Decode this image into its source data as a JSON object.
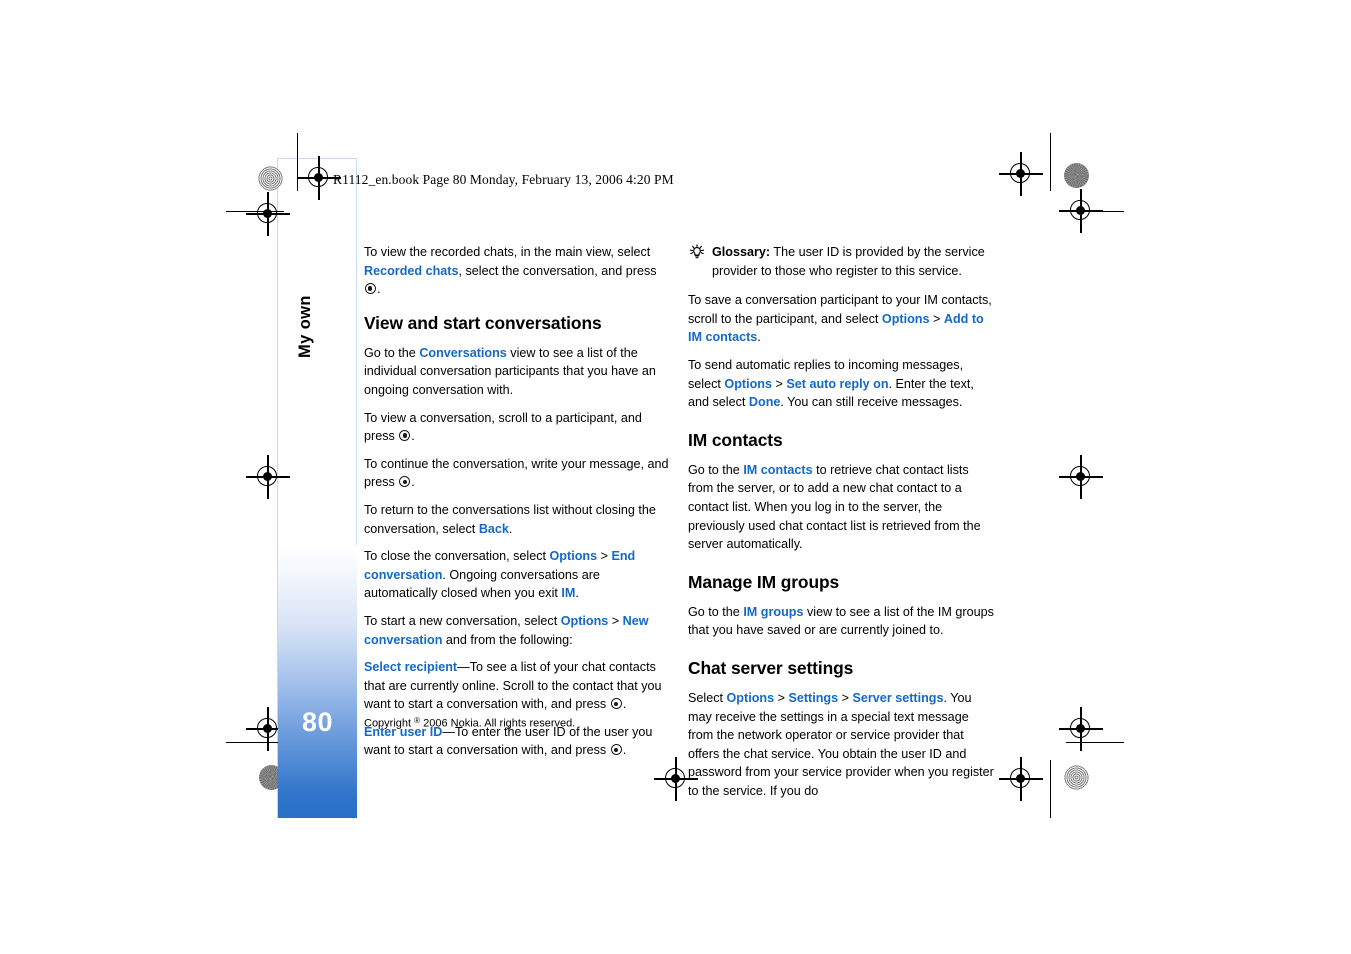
{
  "prepress": {
    "running_header": "R1112_en.book  Page 80  Monday, February 13, 2006  4:20 PM"
  },
  "tab": {
    "page_number": "80",
    "chapter_label": "My own"
  },
  "left_column": {
    "intro": {
      "before": "To view the recorded chats, in the main view, select ",
      "link": "Recorded chats",
      "after": ", select the conversation, and press "
    },
    "heading": "View and start conversations",
    "p1": {
      "before": "Go to the ",
      "link": "Conversations",
      "after": " view to see a list of the individual conversation participants that you have an ongoing conversation with."
    },
    "p2": {
      "before": "To view a conversation, scroll to a participant, and press "
    },
    "p3": {
      "before": "To continue the conversation, write your message, and press "
    },
    "p4": {
      "before": "To return to the conversations list without closing the conversation, select ",
      "link": "Back",
      "after": "."
    },
    "p5": {
      "before": "To close the conversation, select ",
      "link1": "Options",
      "sep": " > ",
      "link2": "End conversation",
      "after": ". Ongoing conversations are automatically closed when you exit ",
      "link3": "IM",
      "tail": "."
    },
    "p6": {
      "before": "To start a new conversation, select ",
      "link1": "Options",
      "sep": " > ",
      "link2": "New conversation",
      "after": " and from the following:"
    },
    "p7": {
      "link": "Select recipient",
      "after": "—To see a list of your chat contacts that are currently online. Scroll to the contact that you want to start a conversation with, and press "
    },
    "p8": {
      "link": "Enter user ID",
      "after": "—To enter the user ID of the user you want to start a conversation with, and press "
    }
  },
  "right_column": {
    "glossary": {
      "label": "Glossary:",
      "text": " The user ID is provided by the service provider to those who register to this service."
    },
    "p1": {
      "before": "To save a conversation participant to your IM contacts, scroll to the participant, and select ",
      "link1": "Options",
      "sep": " > ",
      "link2": "Add to IM contacts",
      "after": "."
    },
    "p2": {
      "before": "To send automatic replies to incoming messages, select ",
      "link1": "Options",
      "sep": " > ",
      "link2": "Set auto reply on",
      "mid": ". Enter the text, and select ",
      "link3": "Done",
      "after": ". You can still receive messages."
    },
    "heading1": "IM contacts",
    "p3": {
      "before": "Go to the ",
      "link": "IM contacts",
      "after": " to retrieve chat contact lists from the server, or to add a new chat contact to a contact list. When you log in to the server, the previously used chat contact list is retrieved from the server automatically."
    },
    "heading2": "Manage IM groups",
    "p4": {
      "before": "Go to the ",
      "link": "IM groups",
      "after": " view to see a list of the IM groups that you have saved or are currently joined to."
    },
    "heading3": "Chat server settings",
    "p5": {
      "before": "Select ",
      "link1": "Options",
      "sep1": " > ",
      "link2": "Settings",
      "sep2": " > ",
      "link3": "Server settings",
      "after": ". You may receive the settings in a special text message from the network operator or service provider that offers the chat service. You obtain the user ID and password from your service provider when you register to the service. If you do"
    }
  },
  "footer": {
    "copyright_before": "Copyright ",
    "copyright_symbol": "®",
    "copyright_after": " 2006 Nokia. All rights reserved."
  },
  "colors": {
    "link_blue": "#1469c8",
    "tab_blue": "#2a6fc6"
  }
}
